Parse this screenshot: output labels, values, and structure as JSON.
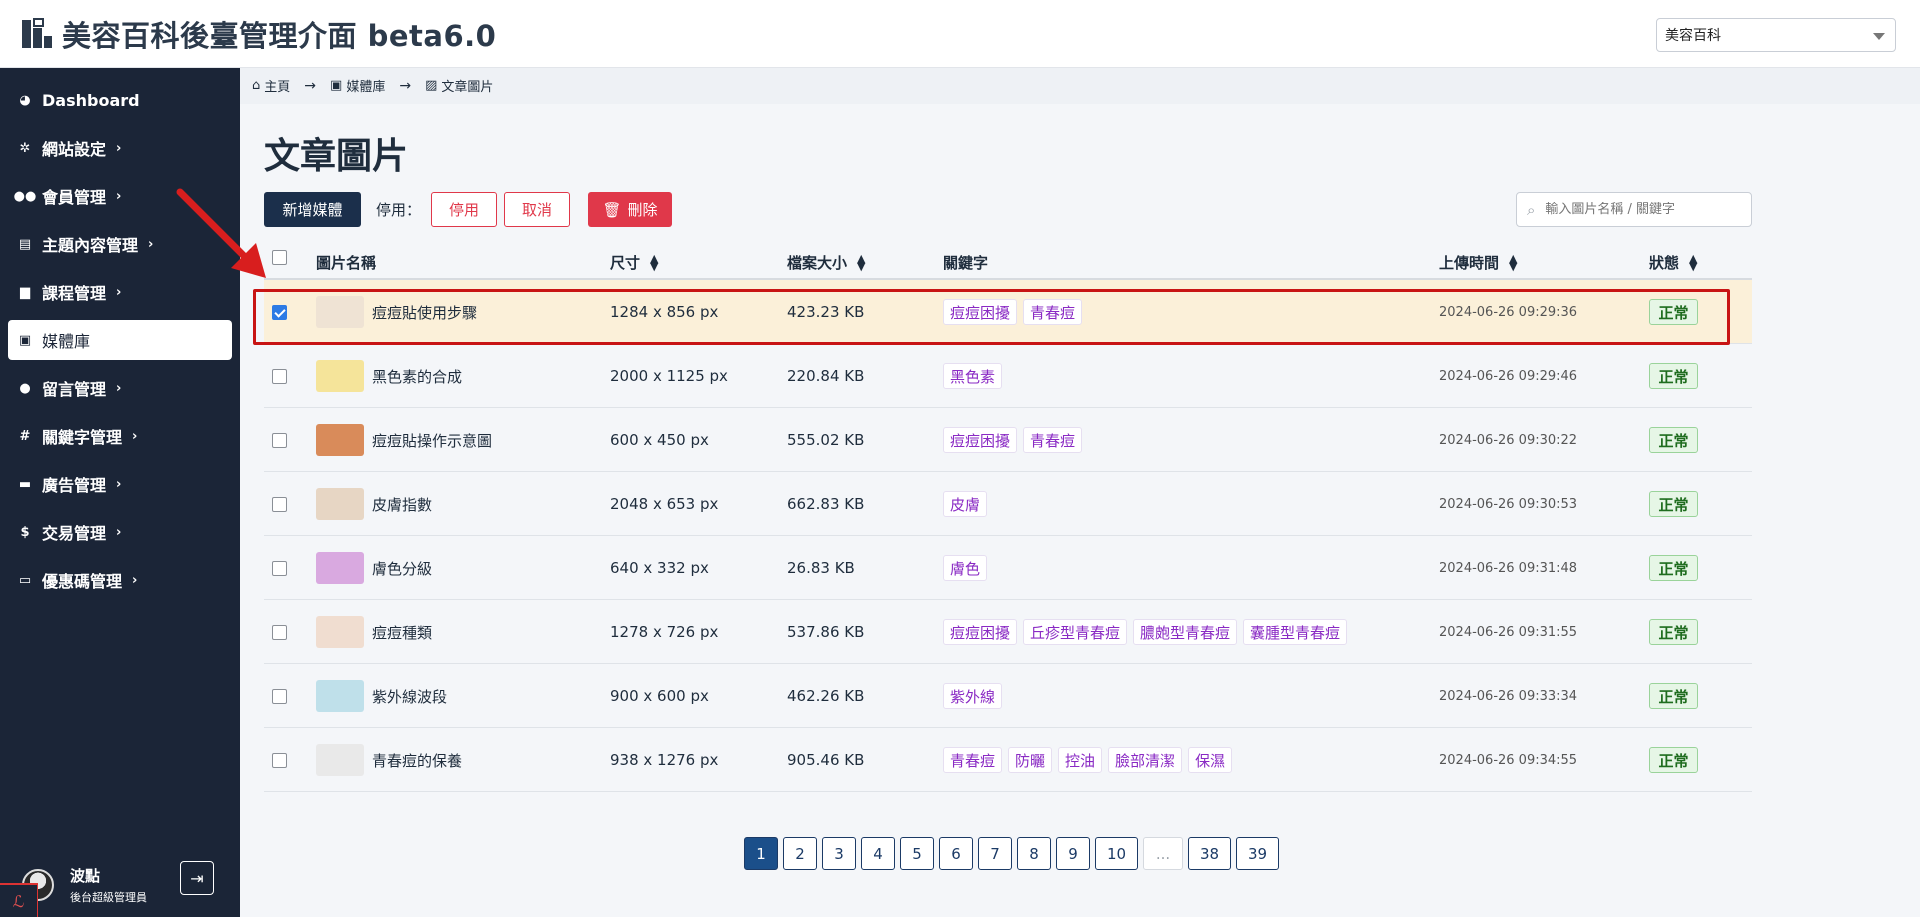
{
  "header": {
    "title": "美容百科後臺管理介面 beta6.0",
    "site_select": "美容百科"
  },
  "sidebar": {
    "items": [
      {
        "label": "Dashboard",
        "icon": "dashboard-icon",
        "chevron": false,
        "active": false
      },
      {
        "label": "網站設定",
        "icon": "gear-icon",
        "chevron": true,
        "active": false
      },
      {
        "label": "會員管理",
        "icon": "users-icon",
        "chevron": true,
        "active": false
      },
      {
        "label": "主題內容管理",
        "icon": "folder-icon",
        "chevron": true,
        "active": false
      },
      {
        "label": "課程管理",
        "icon": "book-icon",
        "chevron": true,
        "active": false
      },
      {
        "label": "媒體庫",
        "icon": "images-icon",
        "chevron": false,
        "active": true
      },
      {
        "label": "留言管理",
        "icon": "comment-icon",
        "chevron": true,
        "active": false
      },
      {
        "label": "關鍵字管理",
        "icon": "hashtag-icon",
        "chevron": true,
        "active": false
      },
      {
        "label": "廣告管理",
        "icon": "ad-icon",
        "chevron": true,
        "active": false
      },
      {
        "label": "交易管理",
        "icon": "money-bag-icon",
        "chevron": true,
        "active": false
      },
      {
        "label": "優惠碼管理",
        "icon": "ticket-icon",
        "chevron": true,
        "active": false
      }
    ],
    "user": {
      "name": "波點",
      "role": "後台超級管理員"
    }
  },
  "breadcrumb": [
    {
      "label": "主頁",
      "icon": "home-icon"
    },
    {
      "label": "媒體庫",
      "icon": "images-icon"
    },
    {
      "label": "文章圖片",
      "icon": "image-icon"
    }
  ],
  "page": {
    "title": "文章圖片"
  },
  "toolbar": {
    "add_label": "新增媒體",
    "disable_label": "停用：",
    "disable_button": "停用",
    "cancel_button": "取消",
    "delete_button": "刪除",
    "search_placeholder": "輸入圖片名稱 / 關鍵字"
  },
  "table": {
    "headers": {
      "name": "圖片名稱",
      "size": "尺寸",
      "filesize": "檔案大小",
      "keywords": "關鍵字",
      "uploaded": "上傳時間",
      "status": "狀態"
    },
    "rows": [
      {
        "name": "痘痘貼使用步驟",
        "size": "1284 x 856 px",
        "filesize": "423.23 KB",
        "keywords": [
          "痘痘困擾",
          "青春痘"
        ],
        "uploaded": "2024-06-26 09:29:36",
        "status": "正常",
        "checked": true,
        "thumb_color": "#efe3d4"
      },
      {
        "name": "黑色素的合成",
        "size": "2000 x 1125 px",
        "filesize": "220.84 KB",
        "keywords": [
          "黑色素"
        ],
        "uploaded": "2024-06-26 09:29:46",
        "status": "正常",
        "checked": false,
        "thumb_color": "#f5e49a"
      },
      {
        "name": "痘痘貼操作示意圖",
        "size": "600 x 450 px",
        "filesize": "555.02 KB",
        "keywords": [
          "痘痘困擾",
          "青春痘"
        ],
        "uploaded": "2024-06-26 09:30:22",
        "status": "正常",
        "checked": false,
        "thumb_color": "#d98b5a"
      },
      {
        "name": "皮膚指數",
        "size": "2048 x 653 px",
        "filesize": "662.83 KB",
        "keywords": [
          "皮膚"
        ],
        "uploaded": "2024-06-26 09:30:53",
        "status": "正常",
        "checked": false,
        "thumb_color": "#e7d6c4"
      },
      {
        "name": "膚色分級",
        "size": "640 x 332 px",
        "filesize": "26.83 KB",
        "keywords": [
          "膚色"
        ],
        "uploaded": "2024-06-26 09:31:48",
        "status": "正常",
        "checked": false,
        "thumb_color": "#d9a9e0"
      },
      {
        "name": "痘痘種類",
        "size": "1278 x 726 px",
        "filesize": "537.86 KB",
        "keywords": [
          "痘痘困擾",
          "丘疹型青春痘",
          "膿皰型青春痘",
          "囊腫型青春痘"
        ],
        "uploaded": "2024-06-26 09:31:55",
        "status": "正常",
        "checked": false,
        "thumb_color": "#f0ddd0"
      },
      {
        "name": "紫外線波段",
        "size": "900 x 600 px",
        "filesize": "462.26 KB",
        "keywords": [
          "紫外線"
        ],
        "uploaded": "2024-06-26 09:33:34",
        "status": "正常",
        "checked": false,
        "thumb_color": "#bfe0ea"
      },
      {
        "name": "青春痘的保養",
        "size": "938 x 1276 px",
        "filesize": "905.46 KB",
        "keywords": [
          "青春痘",
          "防曬",
          "控油",
          "臉部清潔",
          "保濕"
        ],
        "uploaded": "2024-06-26 09:34:55",
        "status": "正常",
        "checked": false,
        "thumb_color": "#e9e9e9"
      }
    ]
  },
  "pagination": {
    "pages": [
      "1",
      "2",
      "3",
      "4",
      "5",
      "6",
      "7",
      "8",
      "9",
      "10",
      "...",
      "38",
      "39"
    ],
    "current": "1"
  }
}
